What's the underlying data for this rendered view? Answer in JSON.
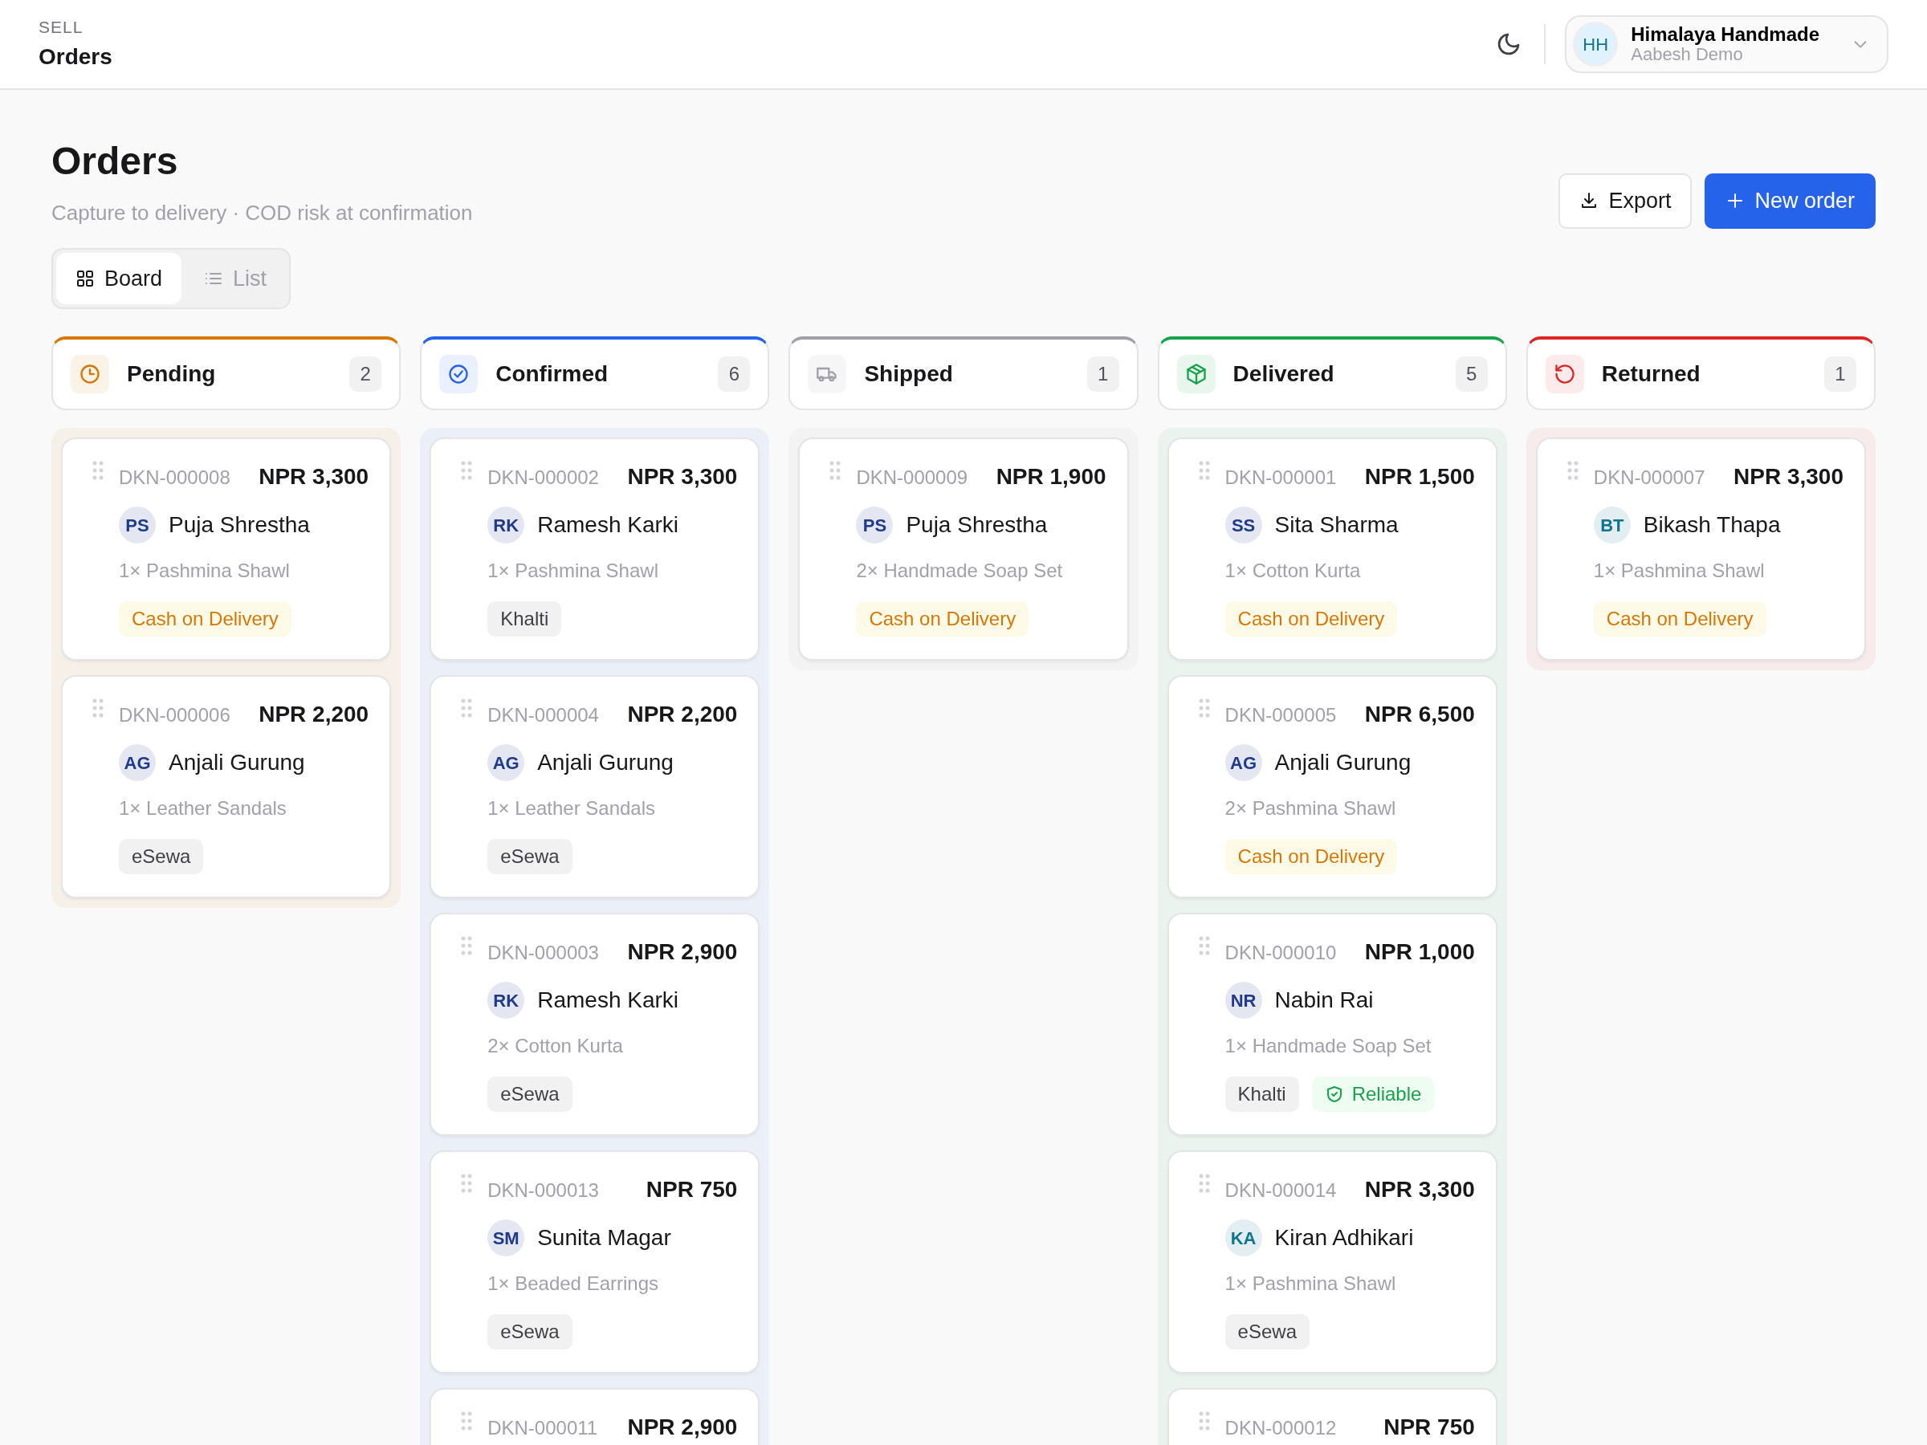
{
  "topbar": {
    "section": "SELL",
    "title": "Orders",
    "account": {
      "initials": "HH",
      "name": "Himalaya Handmade",
      "subtitle": "Aabesh Demo"
    }
  },
  "page": {
    "title": "Orders",
    "subtitle": "Capture to delivery · COD risk at confirmation",
    "actions": [
      {
        "label": "Export",
        "kind": "secondary"
      },
      {
        "label": "New order",
        "kind": "primary"
      }
    ]
  },
  "views": [
    {
      "label": "Board",
      "selected": true,
      "kind": "board"
    },
    {
      "label": "List",
      "selected": false,
      "kind": "list"
    }
  ],
  "columns": [
    {
      "title": "Pending",
      "count": "2",
      "kind": "pending",
      "color": "#d97706",
      "cards": [
        {
          "id": "DKN-000008",
          "amount": "NPR 3,300",
          "customer": {
            "initials": "PS",
            "name": "Puja Shrestha",
            "color": "#1e3a8a"
          },
          "items": "1× Pashmina Shawl",
          "tags": [
            {
              "label": "Cash on Delivery",
              "kind": "cod"
            }
          ]
        },
        {
          "id": "DKN-000006",
          "amount": "NPR 2,200",
          "customer": {
            "initials": "AG",
            "name": "Anjali Gurung",
            "color": "#1e3a8a"
          },
          "items": "1× Leather Sandals",
          "tags": [
            {
              "label": "eSewa",
              "kind": "wallet"
            }
          ]
        }
      ]
    },
    {
      "title": "Confirmed",
      "count": "6",
      "kind": "confirmed",
      "color": "#2563eb",
      "cards": [
        {
          "id": "DKN-000002",
          "amount": "NPR 3,300",
          "customer": {
            "initials": "RK",
            "name": "Ramesh Karki",
            "color": "#1e3a8a"
          },
          "items": "1× Pashmina Shawl",
          "tags": [
            {
              "label": "Khalti",
              "kind": "wallet"
            }
          ]
        },
        {
          "id": "DKN-000004",
          "amount": "NPR 2,200",
          "customer": {
            "initials": "AG",
            "name": "Anjali Gurung",
            "color": "#1e3a8a"
          },
          "items": "1× Leather Sandals",
          "tags": [
            {
              "label": "eSewa",
              "kind": "wallet"
            }
          ]
        },
        {
          "id": "DKN-000003",
          "amount": "NPR 2,900",
          "customer": {
            "initials": "RK",
            "name": "Ramesh Karki",
            "color": "#1e3a8a"
          },
          "items": "2× Cotton Kurta",
          "tags": [
            {
              "label": "eSewa",
              "kind": "wallet"
            }
          ]
        },
        {
          "id": "DKN-000013",
          "amount": "NPR 750",
          "customer": {
            "initials": "SM",
            "name": "Sunita Magar",
            "color": "#1e3a8a"
          },
          "items": "1× Beaded Earrings",
          "tags": [
            {
              "label": "eSewa",
              "kind": "wallet"
            }
          ]
        },
        {
          "id": "DKN-000011",
          "amount": "NPR 2,900"
        }
      ]
    },
    {
      "title": "Shipped",
      "count": "1",
      "kind": "shipped",
      "color": "#a1a1aa",
      "cards": [
        {
          "id": "DKN-000009",
          "amount": "NPR 1,900",
          "customer": {
            "initials": "PS",
            "name": "Puja Shrestha",
            "color": "#1e3a8a"
          },
          "items": "2× Handmade Soap Set",
          "tags": [
            {
              "label": "Cash on Delivery",
              "kind": "cod"
            }
          ]
        }
      ]
    },
    {
      "title": "Delivered",
      "count": "5",
      "kind": "delivered",
      "color": "#16a34a",
      "cards": [
        {
          "id": "DKN-000001",
          "amount": "NPR 1,500",
          "customer": {
            "initials": "SS",
            "name": "Sita Sharma",
            "color": "#1e3a8a"
          },
          "items": "1× Cotton Kurta",
          "tags": [
            {
              "label": "Cash on Delivery",
              "kind": "cod"
            }
          ]
        },
        {
          "id": "DKN-000005",
          "amount": "NPR 6,500",
          "customer": {
            "initials": "AG",
            "name": "Anjali Gurung",
            "color": "#1e3a8a"
          },
          "items": "2× Pashmina Shawl",
          "tags": [
            {
              "label": "Cash on Delivery",
              "kind": "cod"
            }
          ]
        },
        {
          "id": "DKN-000010",
          "amount": "NPR 1,000",
          "customer": {
            "initials": "NR",
            "name": "Nabin Rai",
            "color": "#1e3a8a"
          },
          "items": "1× Handmade Soap Set",
          "tags": [
            {
              "label": "Khalti",
              "kind": "wallet"
            },
            {
              "label": "Reliable",
              "kind": "reliable"
            }
          ]
        },
        {
          "id": "DKN-000014",
          "amount": "NPR 3,300",
          "customer": {
            "initials": "KA",
            "name": "Kiran Adhikari",
            "color": "#0e7490"
          },
          "items": "1× Pashmina Shawl",
          "tags": [
            {
              "label": "eSewa",
              "kind": "wallet"
            }
          ]
        },
        {
          "id": "DKN-000012",
          "amount": "NPR 750"
        }
      ]
    },
    {
      "title": "Returned",
      "count": "1",
      "kind": "returned",
      "color": "#dc2626",
      "cards": [
        {
          "id": "DKN-000007",
          "amount": "NPR 3,300",
          "customer": {
            "initials": "BT",
            "name": "Bikash Thapa",
            "color": "#0e7490"
          },
          "items": "1× Pashmina Shawl",
          "tags": [
            {
              "label": "Cash on Delivery",
              "kind": "cod"
            }
          ]
        }
      ]
    }
  ]
}
